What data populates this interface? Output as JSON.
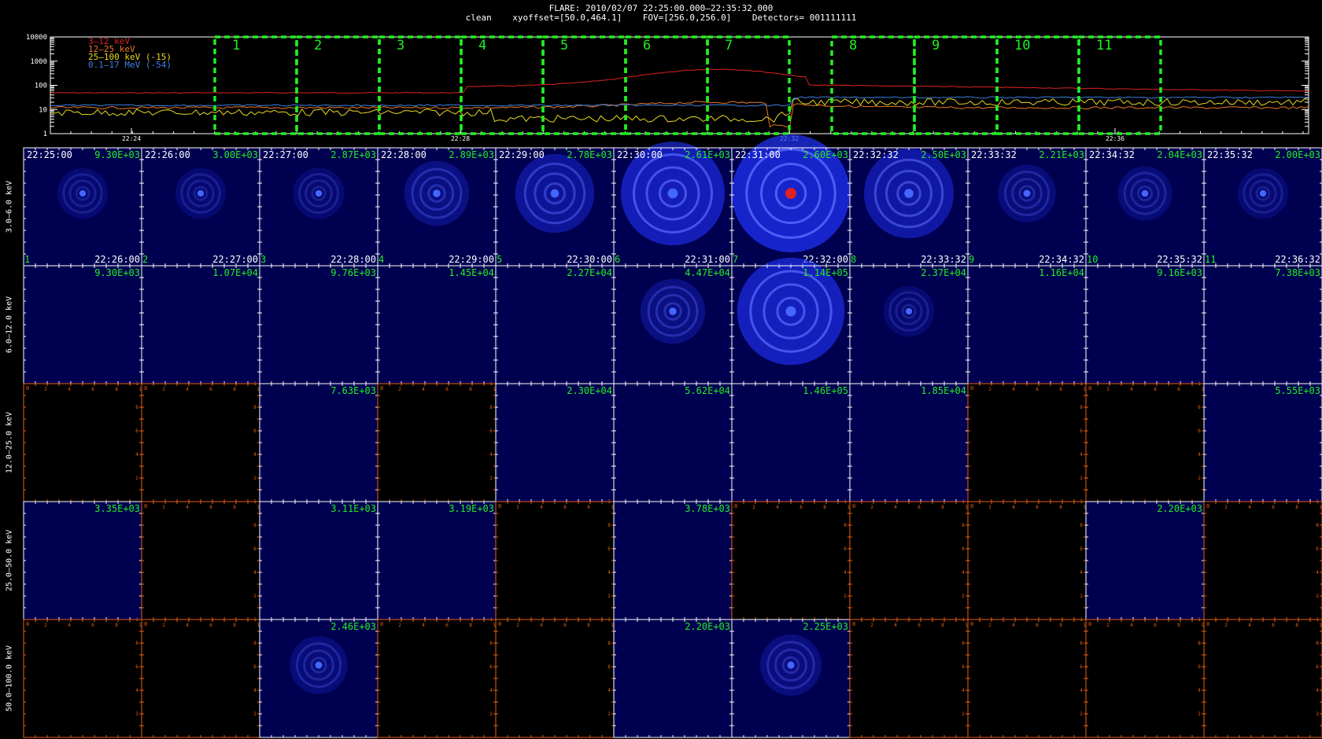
{
  "header": {
    "line1": "FLARE: 2010/02/07 22:25:00.000—22:35:32.000",
    "line2": "clean    xyoffset=[50.0,464.1]    FOV=[256.0,256.0]    Detectors= 001111111"
  },
  "lightcurve": {
    "y_ticks": [
      "10000",
      "1000",
      "100",
      "10",
      "1"
    ],
    "x_ticks": [
      "22:24",
      "22:28",
      "22:32",
      "22:36"
    ],
    "legend": [
      {
        "label": "3—12 keV",
        "color": "#dd2222"
      },
      {
        "label": "12—25 keV",
        "color": "#e87820"
      },
      {
        "label": "25—100 keV (-15)",
        "color": "#e8d820"
      },
      {
        "label": "0.1—17 MeV (-54)",
        "color": "#3a80e0"
      }
    ],
    "intervals": [
      "1",
      "2",
      "3",
      "4",
      "5",
      "6",
      "7",
      "8",
      "9",
      "10",
      "11"
    ],
    "interval_color": "#22ee22"
  },
  "grid": {
    "row_labels": [
      "3.0—6.0 keV",
      "6.0—12.0 keV",
      "12.0—25.0 keV",
      "25.0—50.0 keV",
      "50.0—100.0 keV"
    ],
    "start_times": [
      "22:25:00",
      "22:26:00",
      "22:27:00",
      "22:28:00",
      "22:29:00",
      "22:30:00",
      "22:31:00",
      "22:32:32",
      "22:33:32",
      "22:34:32",
      "22:35:32"
    ],
    "end_times": [
      "22:26:00",
      "22:27:00",
      "22:28:00",
      "22:29:00",
      "22:30:00",
      "22:31:00",
      "22:32:00",
      "22:33:32",
      "22:34:32",
      "22:35:32",
      "22:36:32"
    ],
    "interval_numbers": [
      "1",
      "2",
      "3",
      "4",
      "5",
      "6",
      "7",
      "8",
      "9",
      "10",
      "11"
    ],
    "peaks": [
      [
        "9.30E+03",
        "3.00E+03",
        "2.87E+03",
        "2.89E+03",
        "2.78E+03",
        "2.61E+03",
        "2.60E+03",
        "2.50E+03",
        "2.21E+03",
        "2.04E+03",
        "2.00E+03"
      ],
      [
        "9.30E+03",
        "1.07E+04",
        "9.76E+03",
        "1.45E+04",
        "2.27E+04",
        "4.47E+04",
        "1.14E+05",
        "2.37E+04",
        "1.16E+04",
        "9.16E+03",
        "7.38E+03"
      ],
      [
        "",
        "",
        "7.63E+03",
        "",
        "2.30E+04",
        "5.62E+04",
        "1.46E+05",
        "1.85E+04",
        "",
        "",
        "5.55E+03"
      ],
      [
        "3.35E+03",
        "",
        "3.11E+03",
        "3.19E+03",
        "",
        "3.78E+03",
        "",
        "",
        "",
        "2.20E+03",
        ""
      ],
      [
        "",
        "",
        "2.46E+03",
        "",
        "",
        "2.20E+03",
        "2.25E+03",
        "",
        "",
        "",
        ""
      ]
    ],
    "empty_axis_ticks": [
      "2",
      "4",
      "6",
      "8",
      "1"
    ],
    "colors": {
      "cell_bg": "#000050",
      "blue": "#2233ff",
      "green": "#22ee22",
      "orange": "#e86010",
      "white": "#ffffff"
    }
  },
  "intensity": [
    [
      0.05,
      0.05,
      0.06,
      0.25,
      0.45,
      0.8,
      1.0,
      0.6,
      0.15,
      0.1,
      0.05
    ],
    [
      0,
      0,
      0,
      0,
      0,
      0.25,
      0.85,
      0.05,
      0,
      0,
      0
    ],
    [
      0,
      0,
      0,
      0,
      0,
      0,
      0,
      0,
      0,
      0,
      0
    ],
    [
      0,
      0,
      0,
      0,
      0,
      0,
      0,
      0,
      0,
      0,
      0
    ],
    [
      0,
      0,
      0.15,
      0,
      0,
      0,
      0.2,
      0,
      0,
      0,
      0
    ]
  ]
}
